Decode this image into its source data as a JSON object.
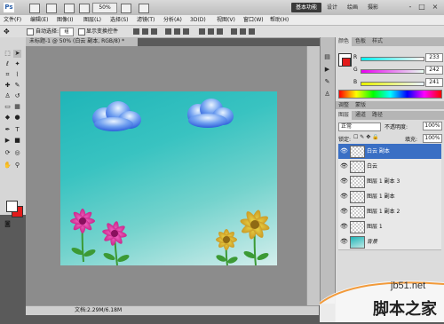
{
  "appbar": {
    "logo": "Ps",
    "zoom": "50%",
    "workspace_active": "基本功能",
    "workspace_items": [
      "设计",
      "绘画",
      "摄影"
    ],
    "window_controls": [
      "-",
      "□",
      "×"
    ]
  },
  "menu": [
    "文件(F)",
    "编辑(E)",
    "图像(I)",
    "图层(L)",
    "选择(S)",
    "滤镜(T)",
    "分析(A)",
    "3D(D)",
    "视图(V)",
    "窗口(W)",
    "帮助(H)"
  ],
  "options": {
    "auto_select": "自动选择:",
    "auto_select_value": "组",
    "show_transform": "显示变换控件"
  },
  "document": {
    "tab_title": "未标题-1 @ 50% (白云 副本, RGB/8) *",
    "status": "文档:2.29M/6.18M"
  },
  "colors_panel": {
    "tabs": [
      "颜色",
      "色板",
      "样式"
    ],
    "channels": [
      {
        "label": "R",
        "value": "233"
      },
      {
        "label": "G",
        "value": "242"
      },
      {
        "label": "B",
        "value": "241"
      }
    ]
  },
  "adjust_tabs": [
    "调整",
    "蒙版"
  ],
  "layers_panel": {
    "tabs": [
      "图层",
      "通道",
      "路径"
    ],
    "blend_mode": "正常",
    "opacity_label": "不透明度:",
    "opacity_value": "100%",
    "lock_label": "锁定:",
    "fill_label": "填充:",
    "fill_value": "100%",
    "layers": [
      {
        "name": "白云 副本",
        "selected": true
      },
      {
        "name": "白云",
        "selected": false
      },
      {
        "name": "图层 1 副本 3",
        "selected": false
      },
      {
        "name": "图层 1 副本",
        "selected": false
      },
      {
        "name": "图层 1 副本 2",
        "selected": false
      },
      {
        "name": "图层 1",
        "selected": false
      },
      {
        "name": "背景",
        "selected": false
      }
    ]
  },
  "watermark": {
    "url": "jb51.net",
    "brand": "脚本之家"
  },
  "theme": {
    "accent": "#3a6fc4",
    "bg_swatch": "#e31b1b"
  }
}
